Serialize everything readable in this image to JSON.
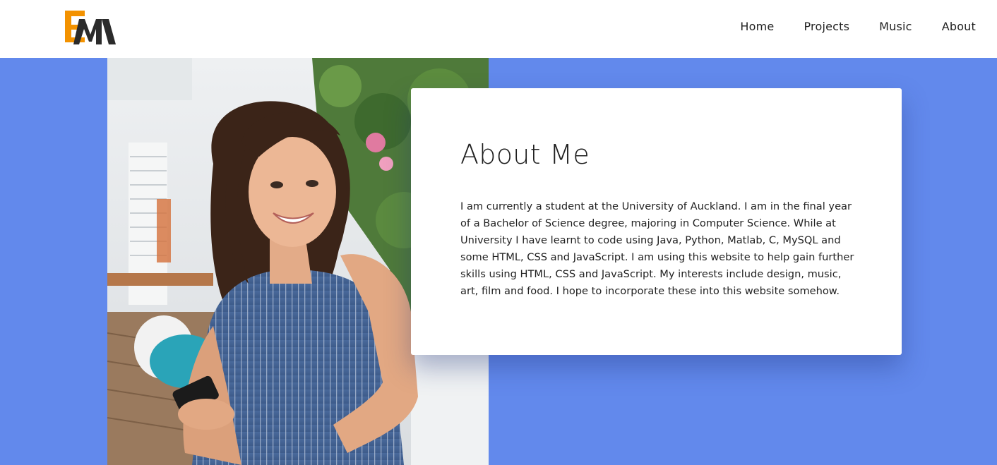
{
  "header": {
    "logo_alt": "EM",
    "nav": [
      {
        "label": "Home"
      },
      {
        "label": "Projects"
      },
      {
        "label": "Music"
      },
      {
        "label": "About"
      }
    ]
  },
  "about": {
    "title": "About Me",
    "body": "I am currently a student at the University of Auckland. I am in the final year of a Bachelor of Science degree, majoring in Computer Science. While at University I have learnt to code using Java, Python, Matlab, C, MySQL and some HTML, CSS and JavaScript. I am using this website to help gain further skills using HTML, CSS and JavaScript. My interests include design, music, art, film and food. I hope to incorporate these into this website somehow."
  },
  "colors": {
    "background": "#6289ec",
    "logo_orange": "#f39200",
    "logo_dark": "#2b2b2b"
  },
  "icons": [
    "em-logo-icon"
  ]
}
